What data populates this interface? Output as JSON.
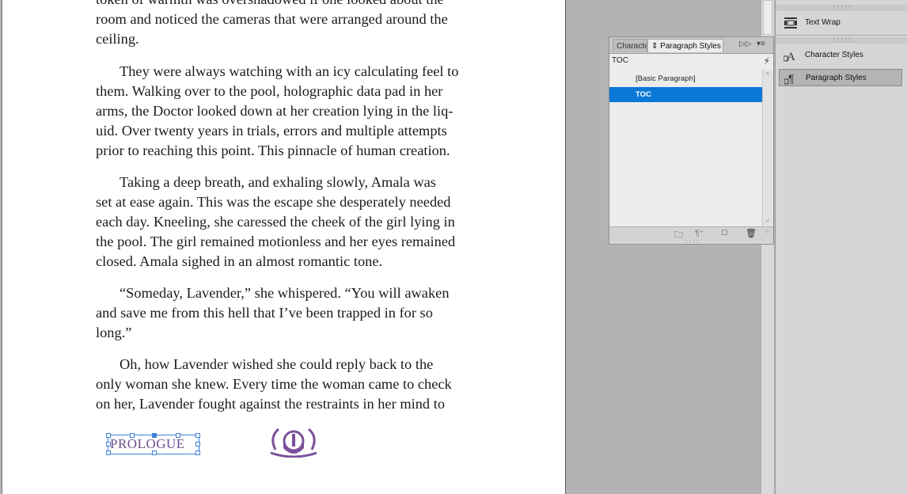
{
  "document": {
    "paragraphs": [
      {
        "indent": false,
        "lines": [
          "token of warmth was overshadowed if one looked about the",
          "room and noticed the cameras that were arranged around the",
          "ceiling."
        ]
      },
      {
        "indent": true,
        "lines": [
          "They were always watching with an icy calculating feel to",
          "them. Walking over to the pool, holographic data pad in her",
          "arms, the Doctor looked down at her creation lying in the liq-",
          "uid. Over twenty years in trials, errors and multiple attempts",
          "prior to reaching this point. This pinnacle of human creation."
        ]
      },
      {
        "indent": true,
        "lines": [
          "Taking a deep breath, and exhaling slowly, Amala was",
          "set at ease again. This was the escape she desperately needed",
          "each day. Kneeling, she caressed the cheek of the girl lying in",
          "the pool. The girl remained motionless and her eyes remained",
          "closed. Amala sighed in an almost romantic tone."
        ]
      },
      {
        "indent": true,
        "lines": [
          "“Someday, Lavender,” she whispered. “You will awaken",
          "and save me from this hell that I’ve been trapped in for so",
          "long.”"
        ]
      },
      {
        "indent": true,
        "lines": [
          "Oh, how Lavender wished she could reply back to the",
          "only woman she knew.  Every time the woman came to check",
          "on her, Lavender fought against the restraints in her mind to"
        ]
      }
    ],
    "folio_text": "PROLOGUE",
    "logo_icon": "ornament-logo-icon",
    "accent_color": "#7b4f9b"
  },
  "styles_panel": {
    "tab_character": "Characte",
    "tab_paragraph": "Paragraph Styles",
    "style_name": "TOC",
    "items": [
      {
        "label": "[Basic Paragraph]",
        "selected": false
      },
      {
        "label": "TOC",
        "selected": true
      }
    ],
    "selection_color": "#0a78d7"
  },
  "dock": {
    "items": [
      {
        "label": "Text Wrap",
        "icon": "text-wrap-icon",
        "active": false
      },
      {
        "label": "Character Styles",
        "icon": "character-styles-icon",
        "active": false
      },
      {
        "label": "Paragraph Styles",
        "icon": "paragraph-styles-icon",
        "active": true
      }
    ]
  }
}
